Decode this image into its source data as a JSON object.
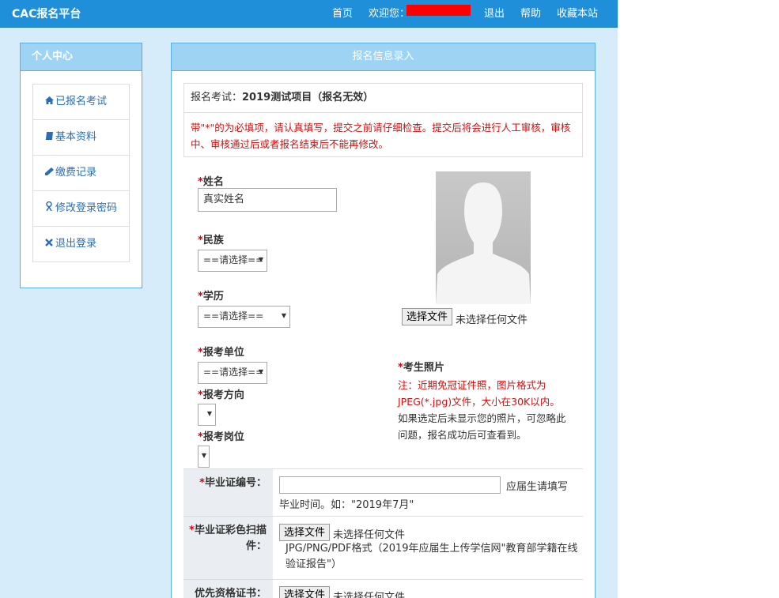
{
  "header": {
    "brand": "CAC报名平台",
    "nav": {
      "home": "首页",
      "welcome": "欢迎您：",
      "logout": "退出",
      "help": "帮助",
      "bookmark": "收藏本站"
    }
  },
  "sidebar": {
    "title": "个人中心",
    "items": [
      {
        "icon": "home-icon",
        "label": "已报名考试"
      },
      {
        "icon": "book-icon",
        "label": "基本资料"
      },
      {
        "icon": "pencil-icon",
        "label": "缴费记录"
      },
      {
        "icon": "user-key-icon",
        "label": "修改登录密码"
      },
      {
        "icon": "close-icon",
        "label": "退出登录"
      }
    ]
  },
  "main": {
    "title": "报名信息录入",
    "exam_prefix": "报名考试：",
    "exam_name": "2019测试项目（报名无效）",
    "notice": "带\"*\"的为必填项，请认真填写，提交之前请仔细检查。提交后将会进行人工审核，审核中、审核通过后或者报名结束后不能再修改。",
    "required_mark": "*",
    "fields": {
      "name_label": "姓名",
      "name_value": "真实姓名",
      "ethnicity_label": "民族",
      "ethnicity_value": "==请选择==",
      "education_label": "学历",
      "education_value": "==请选择==",
      "unit_label": "报考单位",
      "unit_value": "==请选择==",
      "direction_label": "报考方向",
      "position_label": "报考岗位"
    },
    "photo": {
      "choose_button": "选择文件",
      "no_file": "未选择任何文件",
      "label": "考生照片",
      "note_red": "注：近期免冠证件照，图片格式为JPEG(*.jpg)文件，大小在30K以内。",
      "note_black": "如果选定后未显示您的照片，可忽略此问题，报名成功后可查看到。"
    },
    "table": {
      "cert_no_label": "毕业证编号：",
      "cert_no_hint1": "应届生请填写",
      "cert_no_hint2": "毕业时间。如：\"2019年7月\"",
      "cert_scan_label1": "毕业证彩色扫描",
      "cert_scan_label2": "件：",
      "cert_scan_button": "选择文件",
      "cert_scan_no_file": "未选择任何文件",
      "cert_scan_hint": "JPG/PNG/PDF格式（2019年应届生上传学信网\"教育部学籍在线验证报告\"）",
      "priority_label": "优先资格证书：",
      "priority_button": "选择文件",
      "priority_no_file": "未选择任何文件"
    }
  },
  "colors": {
    "header_bg": "#1e8fd8",
    "panel_head_bg": "#9fd3f4",
    "page_bg": "#d6ecfa",
    "required_red": "#d9000e",
    "link_blue": "#2a6fb5",
    "redaction": "#ff0000"
  }
}
